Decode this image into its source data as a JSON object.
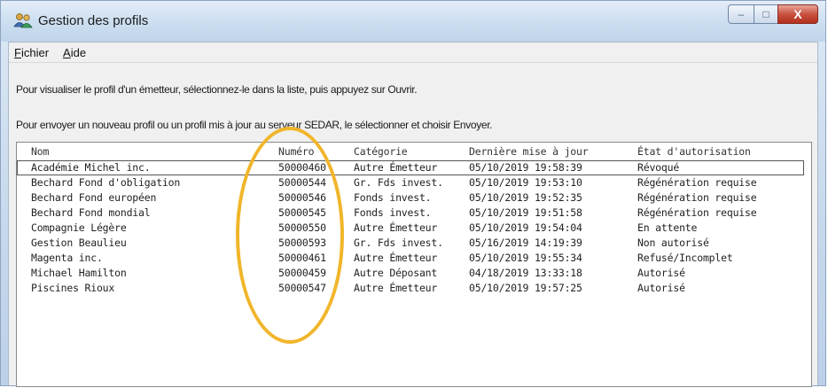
{
  "window": {
    "title": "Gestion des profils",
    "controls": {
      "minimize": "–",
      "maximize": "□",
      "close": "X"
    }
  },
  "menu": [
    {
      "hotkey": "F",
      "rest": "ichier"
    },
    {
      "hotkey": "A",
      "rest": "ide"
    }
  ],
  "instructions": [
    "Pour visualiser le profil d'un émetteur, sélectionnez-le dans la liste, puis appuyez sur Ouvrir.",
    "Pour envoyer un nouveau profil ou un profil mis à jour au serveur SEDAR, le sélectionner et choisir Envoyer."
  ],
  "table": {
    "columns": [
      "Nom",
      "Numéro",
      "Catégorie",
      "Dernière mise à jour",
      "État d'autorisation"
    ],
    "rows": [
      [
        "Académie Michel inc.",
        "50000460",
        "Autre Émetteur",
        "05/10/2019   19:58:39",
        "Révoqué"
      ],
      [
        "Bechard Fond d'obligation",
        "50000544",
        "Gr. Fds invest.",
        "05/10/2019   19:53:10",
        "Régénération requise"
      ],
      [
        "Bechard Fond européen",
        "50000546",
        "Fonds invest.",
        "05/10/2019   19:52:35",
        "Régénération requise"
      ],
      [
        "Bechard Fond mondial",
        "50000545",
        "Fonds invest.",
        "05/10/2019   19:51:58",
        "Régénération requise"
      ],
      [
        "Compagnie Légère",
        "50000550",
        "Autre Émetteur",
        "05/10/2019   19:54:04",
        "En attente"
      ],
      [
        "Gestion Beaulieu",
        "50000593",
        "Gr. Fds invest.",
        "05/16/2019   14:19:39",
        "Non autorisé"
      ],
      [
        "Magenta inc.",
        "50000461",
        "Autre Émetteur",
        "05/10/2019   19:55:34",
        "Refusé/Incomplet"
      ],
      [
        "Michael Hamilton",
        "50000459",
        "Autre Déposant",
        "04/18/2019   13:33:18",
        "Autorisé"
      ],
      [
        "Piscines Rioux",
        "50000547",
        "Autre Émetteur",
        "05/10/2019   19:57:25",
        "Autorisé"
      ]
    ],
    "selected_row": 0
  },
  "colors": {
    "annotation": "#f1b52a",
    "titlebar": "#cddff1",
    "close_button": "#c8513f"
  }
}
